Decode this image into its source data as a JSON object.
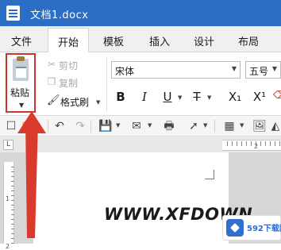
{
  "titlebar": {
    "title": "文档1.docx"
  },
  "menu": {
    "items": [
      {
        "label": "文件"
      },
      {
        "label": "开始"
      },
      {
        "label": "模板"
      },
      {
        "label": "插入"
      },
      {
        "label": "设计"
      },
      {
        "label": "布局"
      }
    ],
    "active_index": 1
  },
  "ribbon": {
    "paste_label": "粘贴",
    "cut_label": "剪切",
    "copy_label": "复制",
    "format_painter_label": "格式刷",
    "font_name": "宋体",
    "font_size": "五号",
    "format_buttons": [
      "B",
      "I",
      "U",
      "T",
      "X₁",
      "X¹"
    ]
  },
  "toolbar": {
    "icons": [
      "new-icon",
      "open-icon",
      "undo-icon",
      "redo-icon",
      "save-icon",
      "email-icon",
      "print-icon",
      "pointer-icon",
      "table-icon",
      "image-icon"
    ]
  },
  "rulers": {
    "vertical_labels": [
      "1",
      "2"
    ],
    "horizontal_label": "2"
  },
  "watermark": {
    "text": "WWW.XFDOWN"
  },
  "badge": {
    "text": "592下载网"
  },
  "colors": {
    "titlebar": "#2b6ec6",
    "highlight": "#c9372c",
    "arrow": "#d93a2b"
  }
}
